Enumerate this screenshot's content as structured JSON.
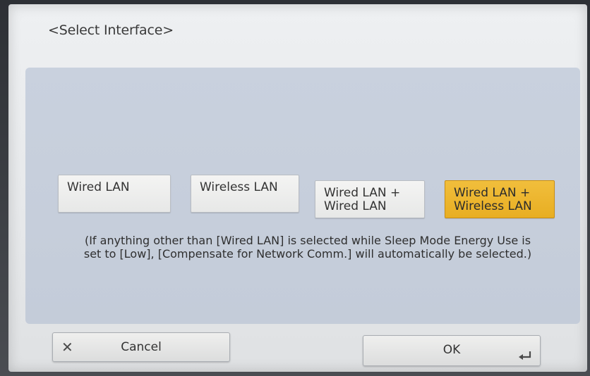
{
  "dialog": {
    "title": "<Select Interface>"
  },
  "options": [
    {
      "line1": "Wired LAN",
      "line2": "",
      "selected": false
    },
    {
      "line1": "Wireless LAN",
      "line2": "",
      "selected": false
    },
    {
      "line1": "Wired LAN +",
      "line2": "Wired LAN",
      "selected": false
    },
    {
      "line1": "Wired LAN +",
      "line2": "Wireless LAN",
      "selected": true
    }
  ],
  "note": {
    "line1": "(If anything other than [Wired LAN] is selected while Sleep Mode Energy Use is",
    "line2": "set to [Low], [Compensate for Network Comm.] will automatically be selected.)"
  },
  "buttons": {
    "cancel_label": "Cancel",
    "cancel_icon": "close-icon",
    "ok_label": "OK",
    "ok_icon": "enter-icon"
  },
  "colors": {
    "selected_option": "#e8ae22",
    "panel": "#c6cedb"
  }
}
